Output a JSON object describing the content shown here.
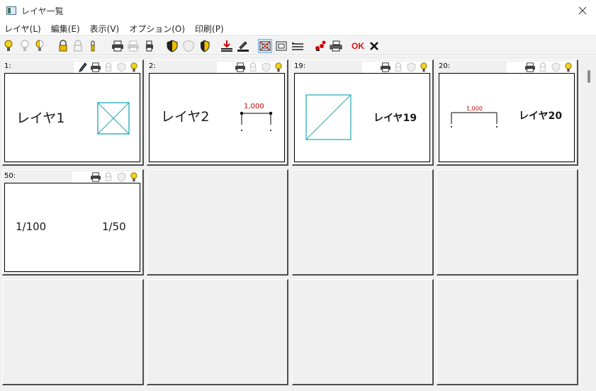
{
  "window": {
    "title": "レイヤ一覧"
  },
  "menu": [
    {
      "label": "レイヤ(L)"
    },
    {
      "label": "編集(E)"
    },
    {
      "label": "表示(V)"
    },
    {
      "label": "オプション(O)"
    },
    {
      "label": "印刷(P)"
    }
  ],
  "toolbar": {
    "ok_label": "OK"
  },
  "layers": [
    {
      "header": "1:",
      "name": "レイヤ1"
    },
    {
      "header": "2:",
      "name": "レイヤ2",
      "dimension": "1,000"
    },
    {
      "header": "19:",
      "name": "レイヤ19"
    },
    {
      "header": "20:",
      "name": "レイヤ20",
      "dimension": "1,000"
    },
    {
      "header": "50:",
      "scale_left": "1/100",
      "scale_right": "1/50"
    }
  ],
  "colors": {
    "bulb": "#f5d21a",
    "cyan": "#1aa9b8",
    "dim_red": "#cc0000",
    "ok_red": "#e01010",
    "active_bg": "#cde3f7"
  }
}
